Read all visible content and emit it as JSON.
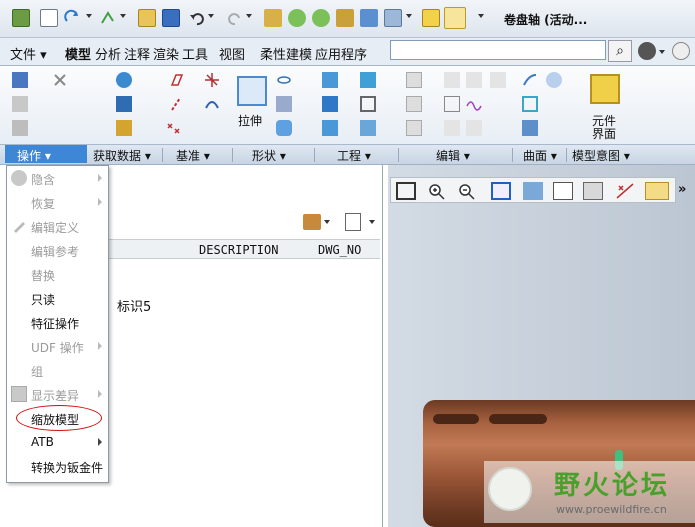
{
  "window": {
    "title": "卷盘轴 (活动..."
  },
  "tabs": [
    {
      "label": "文件",
      "arrow": "▾"
    },
    {
      "label": "模型"
    },
    {
      "label": "分析"
    },
    {
      "label": "注释"
    },
    {
      "label": "渲染"
    },
    {
      "label": "工具"
    },
    {
      "label": "视图"
    },
    {
      "label": "柔性建模"
    },
    {
      "label": "应用程序"
    }
  ],
  "search": {
    "placeholder": ""
  },
  "ribbon": {
    "extrude_label": "拉伸",
    "component_label_1": "元件",
    "component_label_2": "界面"
  },
  "groups": [
    {
      "label": "操作 ▾"
    },
    {
      "label": "获取数据 ▾"
    },
    {
      "label": "基准 ▾"
    },
    {
      "label": "形状 ▾"
    },
    {
      "label": "工程 ▾"
    },
    {
      "label": "编辑 ▾"
    },
    {
      "label": "曲面 ▾"
    },
    {
      "label": "模型意图 ▾"
    }
  ],
  "table": {
    "columns": [
      "DESCRIPTION",
      "DWG_NO"
    ],
    "row_label": "标识5"
  },
  "menu": {
    "items": [
      {
        "label": "隐含",
        "disabled": true,
        "submenu": true,
        "icon": "suppress-icon"
      },
      {
        "label": "恢复",
        "disabled": true,
        "submenu": true
      },
      {
        "label": "编辑定义",
        "disabled": true,
        "icon": "edit-definition-icon"
      },
      {
        "label": "编辑参考",
        "disabled": true
      },
      {
        "label": "替换",
        "disabled": true
      },
      {
        "label": "只读",
        "disabled": false
      },
      {
        "label": "特征操作",
        "disabled": false
      },
      {
        "label": "UDF 操作",
        "disabled": true,
        "submenu": true
      },
      {
        "label": "组",
        "disabled": true
      },
      {
        "label": "显示差异",
        "disabled": true,
        "submenu": true,
        "icon": "show-diff-icon"
      },
      {
        "label": "缩放模型",
        "disabled": false
      },
      {
        "label": "ATB",
        "disabled": false,
        "submenu": true
      },
      {
        "label": "转换为钣金件",
        "disabled": false
      }
    ]
  },
  "watermark": {
    "text": "野火论坛",
    "url": "www.proewildfire.cn"
  },
  "colors": {
    "accent": "#3e87d6",
    "highlight_ellipse": "#d01010",
    "model": "#a8623f",
    "watermark": "#4aa02c"
  }
}
